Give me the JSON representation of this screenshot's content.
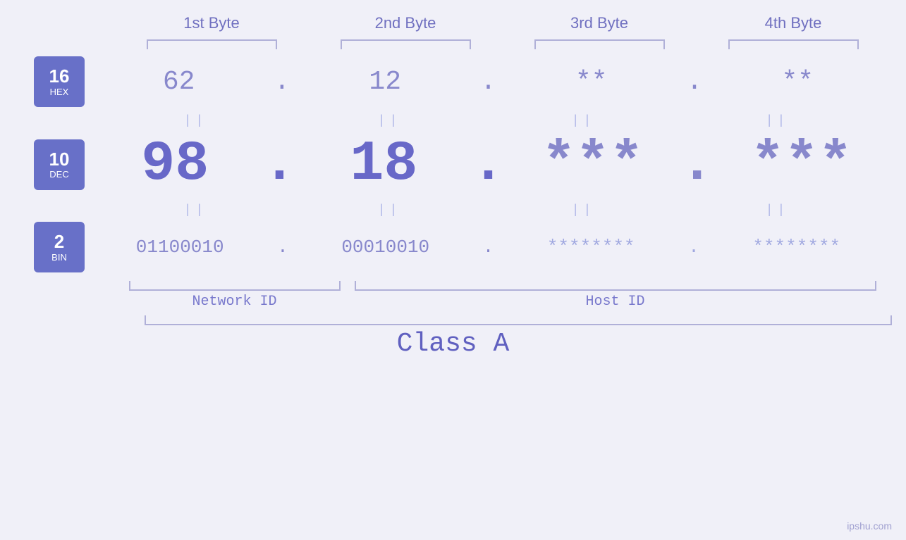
{
  "page": {
    "background": "#f0f0f8",
    "watermark": "ipshu.com"
  },
  "byte_headers": [
    "1st Byte",
    "2nd Byte",
    "3rd Byte",
    "4th Byte"
  ],
  "badges": [
    {
      "number": "16",
      "label": "HEX"
    },
    {
      "number": "10",
      "label": "DEC"
    },
    {
      "number": "2",
      "label": "BIN"
    }
  ],
  "hex_row": {
    "values": [
      "62",
      "12",
      "**",
      "**"
    ],
    "dots": [
      ".",
      ".",
      ".",
      ""
    ]
  },
  "dec_row": {
    "values": [
      "98",
      "18",
      "***",
      "***"
    ],
    "dots": [
      ".",
      ".",
      ".",
      ""
    ]
  },
  "bin_row": {
    "values": [
      "01100010",
      "00010010",
      "********",
      "********"
    ],
    "dots": [
      ".",
      ".",
      ".",
      ""
    ]
  },
  "labels": {
    "network_id": "Network ID",
    "host_id": "Host ID",
    "class": "Class A"
  },
  "equals": "||"
}
